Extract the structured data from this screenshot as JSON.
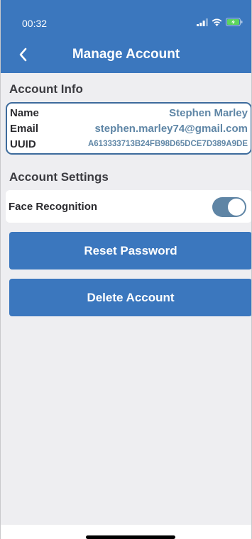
{
  "status_bar": {
    "time": "00:32",
    "icons": [
      "signal-icon",
      "wifi-icon",
      "battery-charging-icon"
    ]
  },
  "nav": {
    "title": "Manage Account",
    "back_icon": "chevron-left-icon"
  },
  "account_info": {
    "header": "Account Info",
    "rows": [
      {
        "label": "Name",
        "value": "Stephen Marley"
      },
      {
        "label": "Email",
        "value": "stephen.marley74@gmail.com"
      },
      {
        "label": "UUID",
        "value": "A613333713B24FB98D65DCE7D389A9DE"
      }
    ]
  },
  "account_settings": {
    "header": "Account Settings",
    "face_recognition": {
      "label": "Face Recognition",
      "enabled": true
    }
  },
  "buttons": {
    "reset_password": "Reset Password",
    "delete_account": "Delete Account"
  },
  "colors": {
    "primary": "#3b77be",
    "accent": "#5f86a6",
    "background": "#eeeef1"
  }
}
